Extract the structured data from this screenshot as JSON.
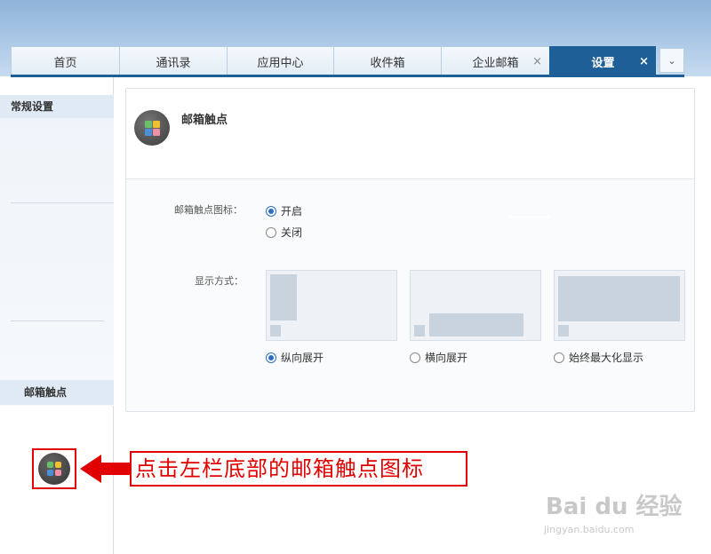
{
  "tabs": [
    {
      "label": "首页",
      "active": false,
      "closable": false
    },
    {
      "label": "通讯录",
      "active": false,
      "closable": false
    },
    {
      "label": "应用中心",
      "active": false,
      "closable": false
    },
    {
      "label": "收件箱",
      "active": false,
      "closable": false
    },
    {
      "label": "企业邮箱",
      "active": false,
      "closable": true
    },
    {
      "label": "设置",
      "active": true,
      "closable": true
    }
  ],
  "tab_close_glyph": "×",
  "tab_more_glyph": "⌄",
  "sidebar": {
    "header": "常规设置",
    "item": "邮箱触点"
  },
  "panel": {
    "title": "邮箱触点",
    "icon_label": "邮箱触点图标：",
    "icon_options": [
      "开启",
      "关闭"
    ],
    "icon_selected": 0,
    "display_label": "显示方式：",
    "display_options": [
      "纵向展开",
      "横向展开",
      "始终最大化显示"
    ],
    "display_selected": 0
  },
  "callout": "点击左栏底部的邮箱触点图标",
  "watermark": {
    "brand": "Bai du 经验",
    "url": "jingyan.baidu.com"
  },
  "colors": {
    "accent": "#1f5f98",
    "callout_red": "#e00000",
    "radio_blue": "#2a6fc0",
    "icon_green": "#6abf69",
    "icon_yellow": "#f0c030",
    "icon_blue": "#4a90d9",
    "icon_pink": "#ef8fa8"
  }
}
